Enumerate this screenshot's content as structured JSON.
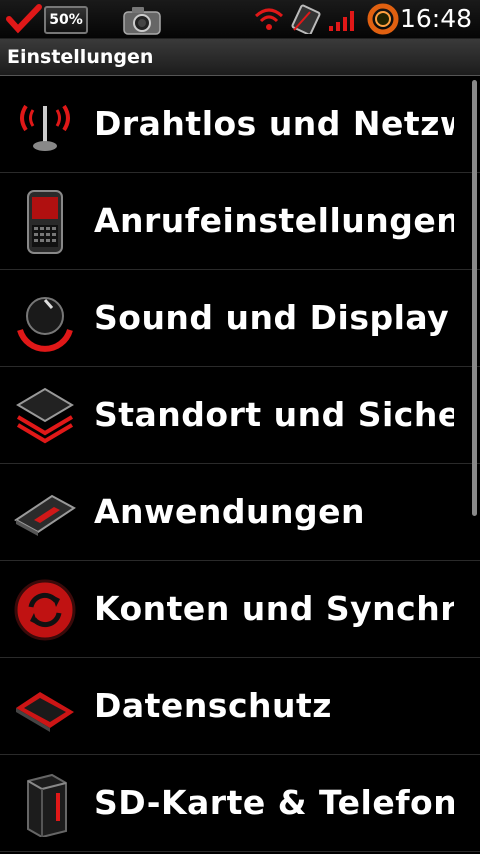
{
  "status_bar": {
    "battery": "50%",
    "time": "16:48",
    "icons": [
      "check-icon",
      "battery-icon",
      "camera-icon",
      "wifi-icon",
      "sim-icon",
      "signal-icon",
      "ring-icon"
    ]
  },
  "title": "Einstellungen",
  "items": [
    {
      "label": "Drahtlos und Netzwe",
      "icon": "antenna-icon"
    },
    {
      "label": "Anrufeinstellungen",
      "icon": "phone-icon"
    },
    {
      "label": "Sound und Display",
      "icon": "speaker-knob-icon"
    },
    {
      "label": "Standort und Sicherh",
      "icon": "layers-icon"
    },
    {
      "label": "Anwendungen",
      "icon": "card-icon"
    },
    {
      "label": "Konten und Synchro",
      "icon": "sync-icon"
    },
    {
      "label": "Datenschutz",
      "icon": "tablet-icon"
    },
    {
      "label": "SD-Karte & Telefons",
      "icon": "sd-card-icon"
    }
  ],
  "colors": {
    "accent": "#e01818",
    "background": "#000000",
    "text": "#ffffff"
  }
}
